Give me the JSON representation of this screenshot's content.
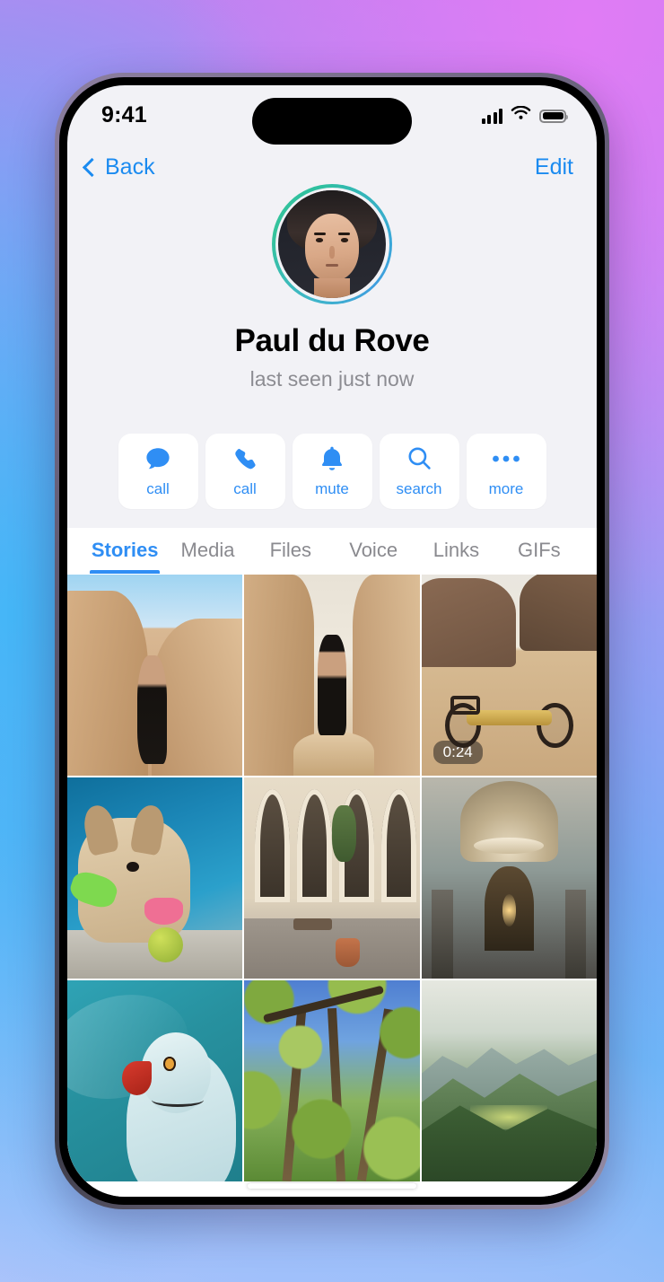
{
  "status_bar": {
    "time": "9:41",
    "cellular_icon": "cellular-bars-icon",
    "wifi_icon": "wifi-icon",
    "battery_icon": "battery-full-icon"
  },
  "nav": {
    "back_label": "Back",
    "back_icon": "chevron-left-icon",
    "edit_label": "Edit"
  },
  "profile": {
    "name": "Paul du Rove",
    "status": "last seen just now",
    "avatar_alt": "user-avatar",
    "story_ring_colors": [
      "#35c39b",
      "#3fb6c9",
      "#3f9ede"
    ]
  },
  "actions": [
    {
      "label": "call",
      "icon": "message-bubble-icon"
    },
    {
      "label": "call",
      "icon": "phone-icon"
    },
    {
      "label": "mute",
      "icon": "bell-icon"
    },
    {
      "label": "search",
      "icon": "search-icon"
    },
    {
      "label": "more",
      "icon": "ellipsis-icon"
    }
  ],
  "tabs": [
    {
      "label": "Stories",
      "active": true
    },
    {
      "label": "Media",
      "active": false
    },
    {
      "label": "Files",
      "active": false
    },
    {
      "label": "Voice",
      "active": false
    },
    {
      "label": "Links",
      "active": false
    },
    {
      "label": "GIFs",
      "active": false
    }
  ],
  "media_grid": [
    {
      "scene": "s-canyon1",
      "alt": "man-standing-in-desert-canyon",
      "duration": ""
    },
    {
      "scene": "s-canyon2",
      "alt": "man-in-hooded-cloak-on-rock",
      "duration": ""
    },
    {
      "scene": "s-desert",
      "alt": "yellow-motorbike-in-desert",
      "duration": "0:24"
    },
    {
      "scene": "s-dog",
      "alt": "french-bulldog-by-pool",
      "duration": ""
    },
    {
      "scene": "s-court",
      "alt": "arched-courtyard-cafe",
      "duration": ""
    },
    {
      "scene": "s-dome",
      "alt": "cathedral-dome-interior",
      "duration": ""
    },
    {
      "scene": "s-parrot",
      "alt": "parrot-on-teal-fabric",
      "duration": ""
    },
    {
      "scene": "s-trees",
      "alt": "tree-canopy-looking-up",
      "duration": ""
    },
    {
      "scene": "s-mtn",
      "alt": "misty-green-mountains",
      "duration": ""
    }
  ],
  "colors": {
    "accent_blue": "#2f8ef4",
    "link_blue": "#1b8bf0",
    "secondary_text": "#8c8c92",
    "screen_bg": "#f2f2f6",
    "card_bg": "#ffffff"
  }
}
